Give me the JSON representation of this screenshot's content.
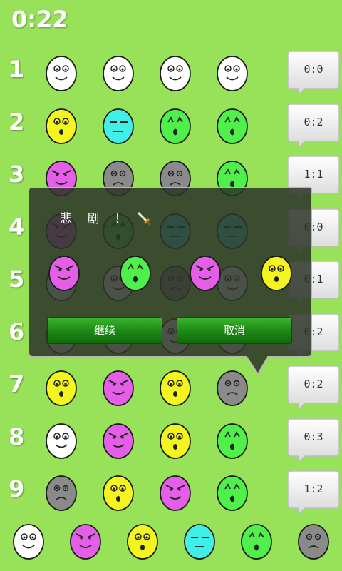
{
  "timer": "0:22",
  "rows": [
    {
      "num": "1",
      "faces": [
        "white",
        "white",
        "white",
        "white"
      ],
      "score": "0:0"
    },
    {
      "num": "2",
      "faces": [
        "yellow",
        "cyan",
        "green",
        "green"
      ],
      "score": "0:2"
    },
    {
      "num": "3",
      "faces": [
        "magenta",
        "gray",
        "gray",
        "green"
      ],
      "score": "1:1"
    },
    {
      "num": "4",
      "faces": [
        "magenta",
        "green",
        "cyan",
        "cyan"
      ],
      "score": "0:0"
    },
    {
      "num": "5",
      "faces": [
        "white",
        "white",
        "gray",
        "white"
      ],
      "score": "0:1"
    },
    {
      "num": "6",
      "faces": [
        "white",
        "white",
        "white",
        "white"
      ],
      "score": "0:2"
    },
    {
      "num": "7",
      "faces": [
        "yellow",
        "magenta",
        "yellow",
        "gray"
      ],
      "score": "0:2"
    },
    {
      "num": "8",
      "faces": [
        "white",
        "magenta",
        "yellow",
        "green"
      ],
      "score": "0:3"
    },
    {
      "num": "9",
      "faces": [
        "gray",
        "yellow",
        "magenta",
        "green"
      ],
      "score": "1:2"
    }
  ],
  "palette": [
    "white",
    "magenta",
    "yellow",
    "cyan",
    "green",
    "gray"
  ],
  "colors": {
    "background": "#98e25a",
    "white": "#ffffff",
    "yellow": "#f4f41e",
    "cyan": "#3ef0e8",
    "green": "#4ff04a",
    "magenta": "#e45ee8",
    "gray": "#8a8a8a"
  },
  "dialog": {
    "title": "悲 剧 ！",
    "answer": [
      "magenta",
      "green",
      "magenta",
      "yellow"
    ],
    "continue_label": "继续",
    "cancel_label": "取消"
  }
}
